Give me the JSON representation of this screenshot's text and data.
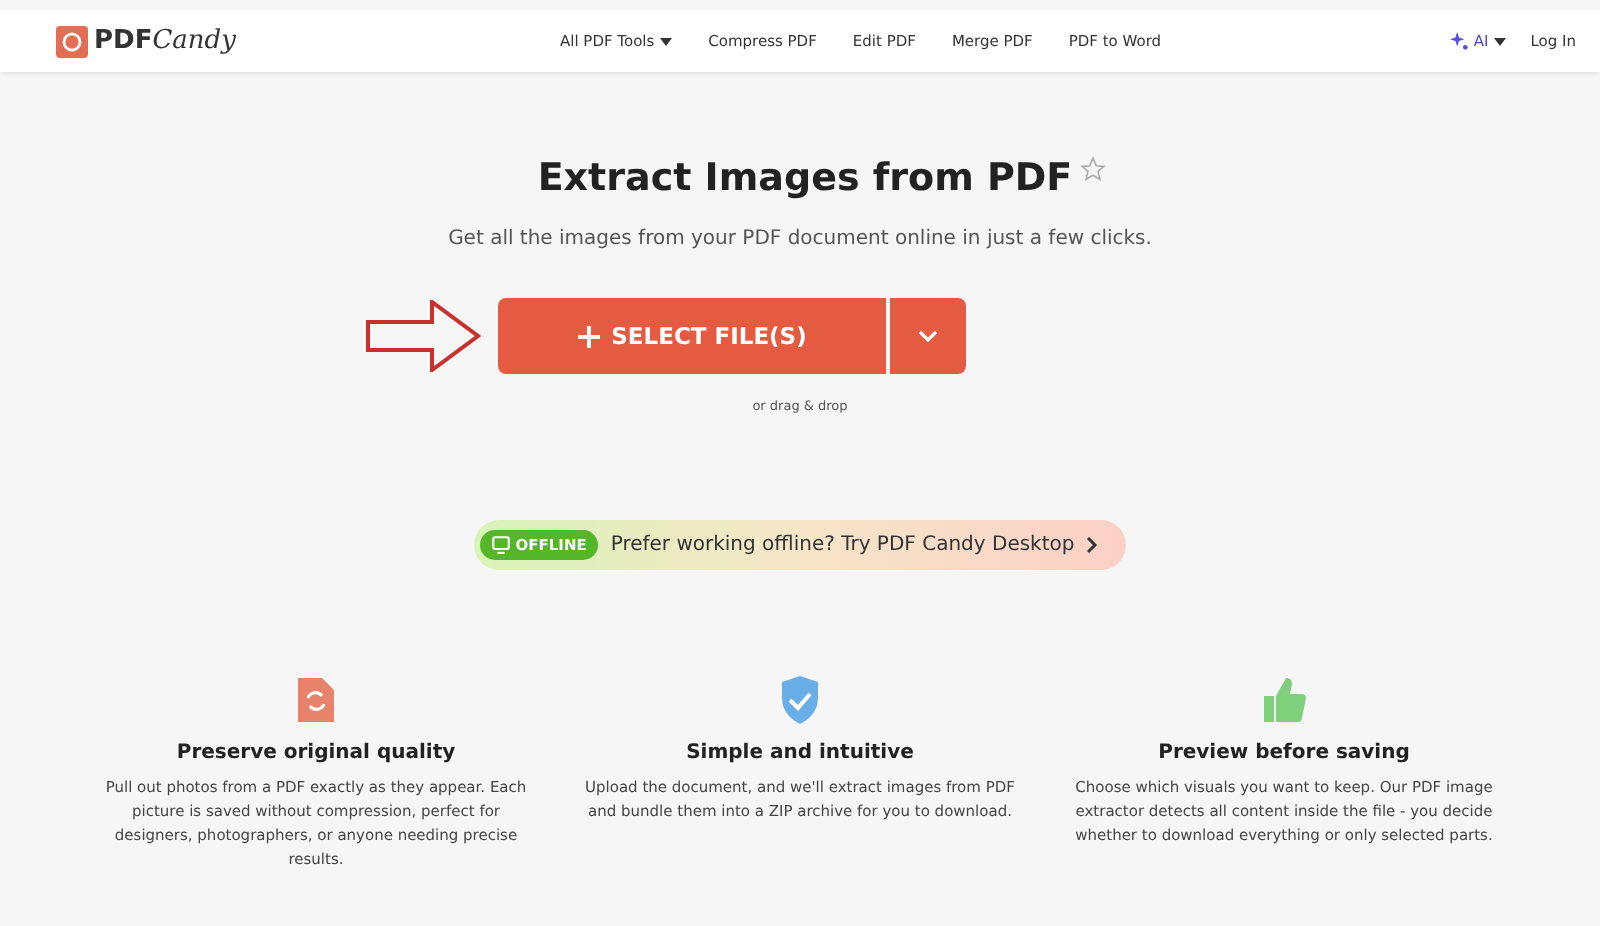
{
  "header": {
    "logo": {
      "strong": "PDF",
      "script": "Candy"
    },
    "nav": [
      {
        "label": "All PDF Tools",
        "dropdown": true
      },
      {
        "label": "Compress PDF",
        "dropdown": false
      },
      {
        "label": "Edit PDF",
        "dropdown": false
      },
      {
        "label": "Merge PDF",
        "dropdown": false
      },
      {
        "label": "PDF to Word",
        "dropdown": false
      }
    ],
    "ai": "AI",
    "login": "Log In"
  },
  "hero": {
    "title": "Extract Images from PDF",
    "favorite": false,
    "subtitle": "Get all the images from your PDF document online in just a few clicks.",
    "button": "SELECT FILE(S)",
    "hint": "or drag & drop"
  },
  "banner": {
    "badge": "OFFLINE",
    "text": "Prefer working offline? Try PDF Candy Desktop"
  },
  "features": [
    {
      "kind": "file",
      "color": "#e8826a",
      "title": "Preserve original quality",
      "text": "Pull out photos from a PDF exactly as they appear. Each picture is saved without compression, perfect for designers, photographers, or anyone needing precise results."
    },
    {
      "kind": "shield",
      "color": "#6aaee8",
      "title": "Simple and intuitive",
      "text": "Upload the document, and we'll extract images from PDF and bundle them into a ZIP archive for you to download."
    },
    {
      "kind": "thumb",
      "color": "#7fd07a",
      "title": "Preview before saving",
      "text": "Choose which visuals you want to keep. Our PDF image extractor detects all content inside the file - you decide whether to download everything or only selected parts."
    }
  ]
}
